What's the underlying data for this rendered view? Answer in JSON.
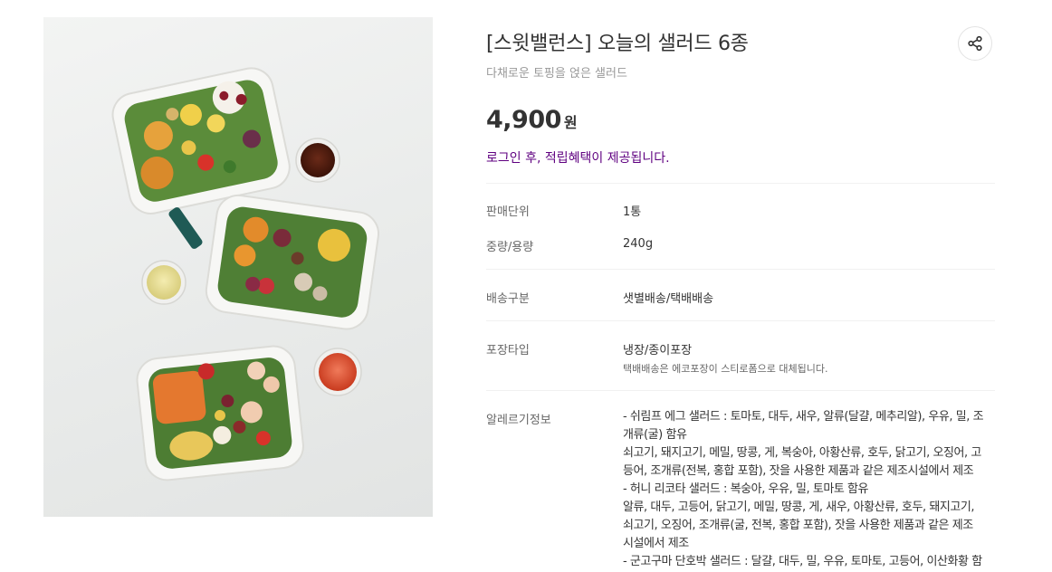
{
  "product": {
    "title": "[스윗밸런스] 오늘의 샐러드 6종",
    "subtitle": "다채로운 토핑을 얹은 샐러드",
    "price": "4,900",
    "price_unit": "원",
    "benefit_notice": "로그인 후, 적립혜택이 제공됩니다.",
    "image_icon": "salad-photo",
    "share_icon": "share-icon"
  },
  "details": {
    "sale_unit": {
      "label": "판매단위",
      "value": "1통"
    },
    "weight": {
      "label": "중량/용량",
      "value": "240g"
    },
    "delivery": {
      "label": "배송구분",
      "value": "샛별배송/택배배송"
    },
    "packaging": {
      "label": "포장타입",
      "value": "냉장/종이포장",
      "note": "택배배송은 에코포장이 스티로폼으로 대체됩니다."
    },
    "allergy": {
      "label": "알레르기정보",
      "lines": [
        "- 쉬림프 에그 샐러드 : 토마토, 대두, 새우, 알류(달걀, 메추리알), 우유, 밀, 조",
        "개류(굴) 함유",
        "쇠고기, 돼지고기, 메밀, 땅콩, 게, 복숭아, 아황산류, 호두, 닭고기, 오징어, 고",
        "등어, 조개류(전복, 홍합 포함), 잣을 사용한 제품과 같은 제조시설에서 제조",
        "- 허니 리코타 샐러드 : 복숭아, 우유, 밀, 토마토 함유",
        "알류, 대두, 고등어, 닭고기, 메밀, 땅콩, 게, 새우, 아황산류, 호두, 돼지고기,",
        "쇠고기, 오징어, 조개류(굴, 전복, 홍합 포함), 잣을 사용한 제품과 같은 제조",
        "시설에서 제조",
        "- 군고구마 단호박 샐러드 : 달걀, 대두, 밀, 우유, 토마토, 고등어, 이산화황 함"
      ]
    }
  },
  "colors": {
    "accent_purple": "#5f0080",
    "text_primary": "#333333",
    "text_secondary": "#999999",
    "divider": "#f1f1f1"
  }
}
